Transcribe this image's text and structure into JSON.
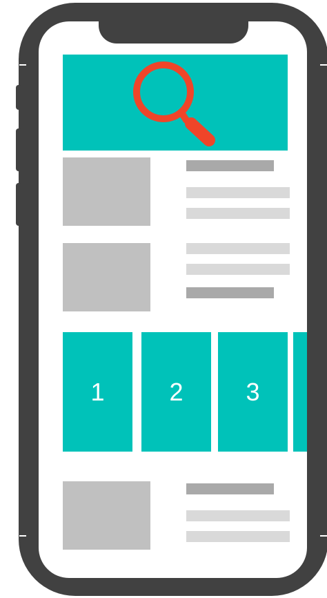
{
  "colors": {
    "frame": "#414141",
    "accent": "#00c2b9",
    "search_icon": "#ef4529",
    "thumbnail": "#c0c0c0",
    "line_dark": "#a9a9a9",
    "line_light": "#d9d9d9"
  },
  "banner": {
    "icon": "search-icon"
  },
  "carousel": {
    "cards": [
      {
        "label": "1"
      },
      {
        "label": "2"
      },
      {
        "label": "3"
      },
      {
        "label": ""
      }
    ]
  }
}
